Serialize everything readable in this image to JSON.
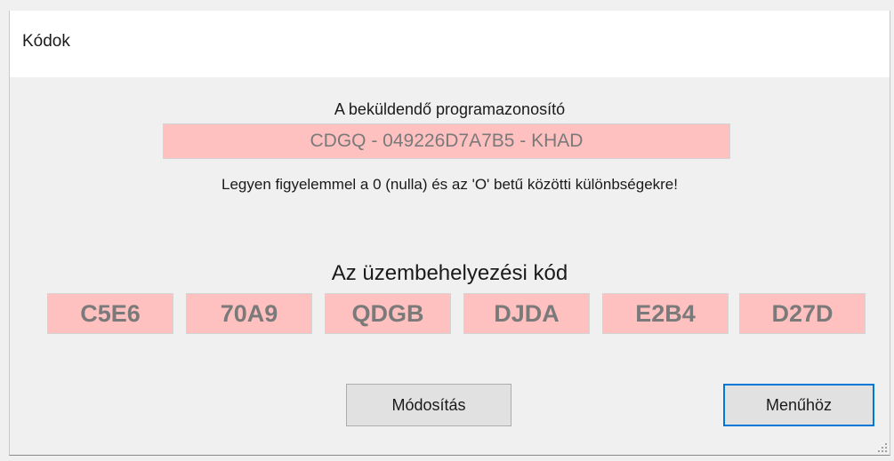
{
  "window": {
    "title": "Kódok"
  },
  "program": {
    "label": "A beküldendő programazonosító",
    "value": "CDGQ - 049226D7A7B5 - KHAD",
    "warning": "Legyen figyelemmel a 0 (nulla) és az 'O' betű közötti különbségekre!"
  },
  "install": {
    "label": "Az üzembehelyezési kód",
    "codes": [
      "C5E6",
      "70A9",
      "QDGB",
      "DJDA",
      "E2B4",
      "D27D"
    ]
  },
  "buttons": {
    "modify": "Módosítás",
    "menu": "Menűhöz"
  },
  "colors": {
    "code_background": "#ffc0c0",
    "code_text": "#7a7a7a",
    "focus_border": "#0078d7"
  }
}
